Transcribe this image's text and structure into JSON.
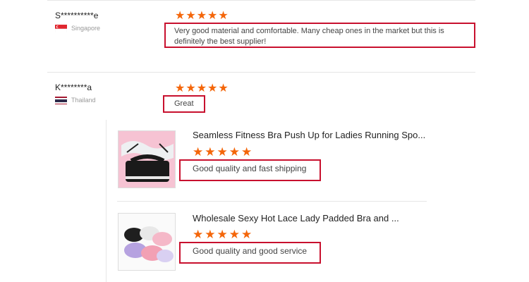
{
  "reviews": [
    {
      "name": "S**********e",
      "country": "Singapore",
      "rating": "★★★★★",
      "text": "Very good material and comfortable. Many cheap ones in the market but this is definitely the best supplier!"
    },
    {
      "name": "K********a",
      "country": "Thailand",
      "rating": "★★★★★",
      "text": "Great"
    }
  ],
  "products": [
    {
      "title": "Seamless Fitness Bra Push Up for Ladies Running Spo...",
      "rating": "★★★★★",
      "text": "Good quality and fast shipping"
    },
    {
      "title": "Wholesale Sexy Hot Lace Lady Padded Bra and ...",
      "rating": "★★★★★",
      "text": "Good quality and good service"
    }
  ],
  "colors": {
    "star": "#f4660a",
    "highlight_box": "#c8102e"
  }
}
